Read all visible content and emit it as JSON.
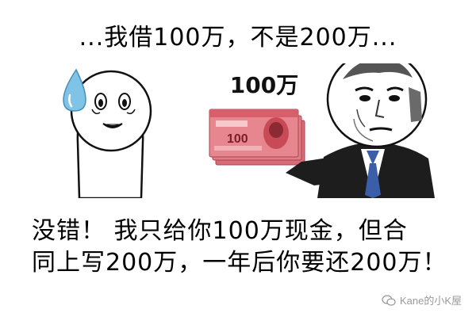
{
  "top_caption": "...我借100万，不是200万...",
  "money_label": "100万",
  "bottom_line1": "没错！ 我只给你100万现金，但合",
  "bottom_line2": "同上写200万，一年后你要还200万！",
  "watermark": "Kane的小K屋",
  "banknote_denomination": "100",
  "colors": {
    "banknote": "#e8868f",
    "suit": "#1d1d1d",
    "tie": "#3a5fa8",
    "drop": "#7fc3e6"
  }
}
